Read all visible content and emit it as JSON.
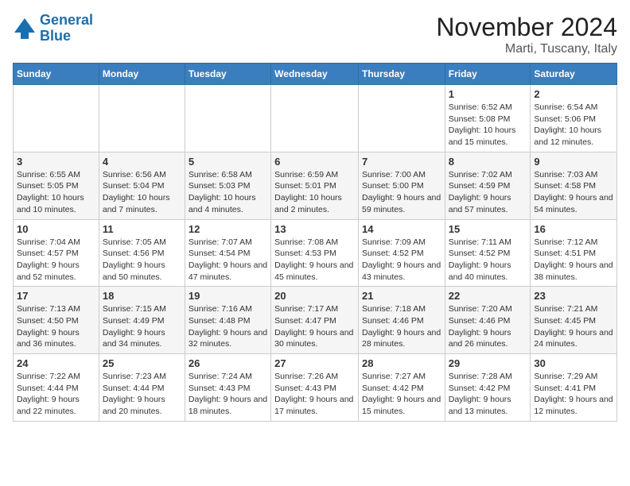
{
  "header": {
    "logo_line1": "General",
    "logo_line2": "Blue",
    "month_title": "November 2024",
    "location": "Marti, Tuscany, Italy"
  },
  "weekdays": [
    "Sunday",
    "Monday",
    "Tuesday",
    "Wednesday",
    "Thursday",
    "Friday",
    "Saturday"
  ],
  "weeks": [
    [
      {
        "day": "",
        "info": ""
      },
      {
        "day": "",
        "info": ""
      },
      {
        "day": "",
        "info": ""
      },
      {
        "day": "",
        "info": ""
      },
      {
        "day": "",
        "info": ""
      },
      {
        "day": "1",
        "info": "Sunrise: 6:52 AM\nSunset: 5:08 PM\nDaylight: 10 hours and 15 minutes."
      },
      {
        "day": "2",
        "info": "Sunrise: 6:54 AM\nSunset: 5:06 PM\nDaylight: 10 hours and 12 minutes."
      }
    ],
    [
      {
        "day": "3",
        "info": "Sunrise: 6:55 AM\nSunset: 5:05 PM\nDaylight: 10 hours and 10 minutes."
      },
      {
        "day": "4",
        "info": "Sunrise: 6:56 AM\nSunset: 5:04 PM\nDaylight: 10 hours and 7 minutes."
      },
      {
        "day": "5",
        "info": "Sunrise: 6:58 AM\nSunset: 5:03 PM\nDaylight: 10 hours and 4 minutes."
      },
      {
        "day": "6",
        "info": "Sunrise: 6:59 AM\nSunset: 5:01 PM\nDaylight: 10 hours and 2 minutes."
      },
      {
        "day": "7",
        "info": "Sunrise: 7:00 AM\nSunset: 5:00 PM\nDaylight: 9 hours and 59 minutes."
      },
      {
        "day": "8",
        "info": "Sunrise: 7:02 AM\nSunset: 4:59 PM\nDaylight: 9 hours and 57 minutes."
      },
      {
        "day": "9",
        "info": "Sunrise: 7:03 AM\nSunset: 4:58 PM\nDaylight: 9 hours and 54 minutes."
      }
    ],
    [
      {
        "day": "10",
        "info": "Sunrise: 7:04 AM\nSunset: 4:57 PM\nDaylight: 9 hours and 52 minutes."
      },
      {
        "day": "11",
        "info": "Sunrise: 7:05 AM\nSunset: 4:56 PM\nDaylight: 9 hours and 50 minutes."
      },
      {
        "day": "12",
        "info": "Sunrise: 7:07 AM\nSunset: 4:54 PM\nDaylight: 9 hours and 47 minutes."
      },
      {
        "day": "13",
        "info": "Sunrise: 7:08 AM\nSunset: 4:53 PM\nDaylight: 9 hours and 45 minutes."
      },
      {
        "day": "14",
        "info": "Sunrise: 7:09 AM\nSunset: 4:52 PM\nDaylight: 9 hours and 43 minutes."
      },
      {
        "day": "15",
        "info": "Sunrise: 7:11 AM\nSunset: 4:52 PM\nDaylight: 9 hours and 40 minutes."
      },
      {
        "day": "16",
        "info": "Sunrise: 7:12 AM\nSunset: 4:51 PM\nDaylight: 9 hours and 38 minutes."
      }
    ],
    [
      {
        "day": "17",
        "info": "Sunrise: 7:13 AM\nSunset: 4:50 PM\nDaylight: 9 hours and 36 minutes."
      },
      {
        "day": "18",
        "info": "Sunrise: 7:15 AM\nSunset: 4:49 PM\nDaylight: 9 hours and 34 minutes."
      },
      {
        "day": "19",
        "info": "Sunrise: 7:16 AM\nSunset: 4:48 PM\nDaylight: 9 hours and 32 minutes."
      },
      {
        "day": "20",
        "info": "Sunrise: 7:17 AM\nSunset: 4:47 PM\nDaylight: 9 hours and 30 minutes."
      },
      {
        "day": "21",
        "info": "Sunrise: 7:18 AM\nSunset: 4:46 PM\nDaylight: 9 hours and 28 minutes."
      },
      {
        "day": "22",
        "info": "Sunrise: 7:20 AM\nSunset: 4:46 PM\nDaylight: 9 hours and 26 minutes."
      },
      {
        "day": "23",
        "info": "Sunrise: 7:21 AM\nSunset: 4:45 PM\nDaylight: 9 hours and 24 minutes."
      }
    ],
    [
      {
        "day": "24",
        "info": "Sunrise: 7:22 AM\nSunset: 4:44 PM\nDaylight: 9 hours and 22 minutes."
      },
      {
        "day": "25",
        "info": "Sunrise: 7:23 AM\nSunset: 4:44 PM\nDaylight: 9 hours and 20 minutes."
      },
      {
        "day": "26",
        "info": "Sunrise: 7:24 AM\nSunset: 4:43 PM\nDaylight: 9 hours and 18 minutes."
      },
      {
        "day": "27",
        "info": "Sunrise: 7:26 AM\nSunset: 4:43 PM\nDaylight: 9 hours and 17 minutes."
      },
      {
        "day": "28",
        "info": "Sunrise: 7:27 AM\nSunset: 4:42 PM\nDaylight: 9 hours and 15 minutes."
      },
      {
        "day": "29",
        "info": "Sunrise: 7:28 AM\nSunset: 4:42 PM\nDaylight: 9 hours and 13 minutes."
      },
      {
        "day": "30",
        "info": "Sunrise: 7:29 AM\nSunset: 4:41 PM\nDaylight: 9 hours and 12 minutes."
      }
    ]
  ]
}
